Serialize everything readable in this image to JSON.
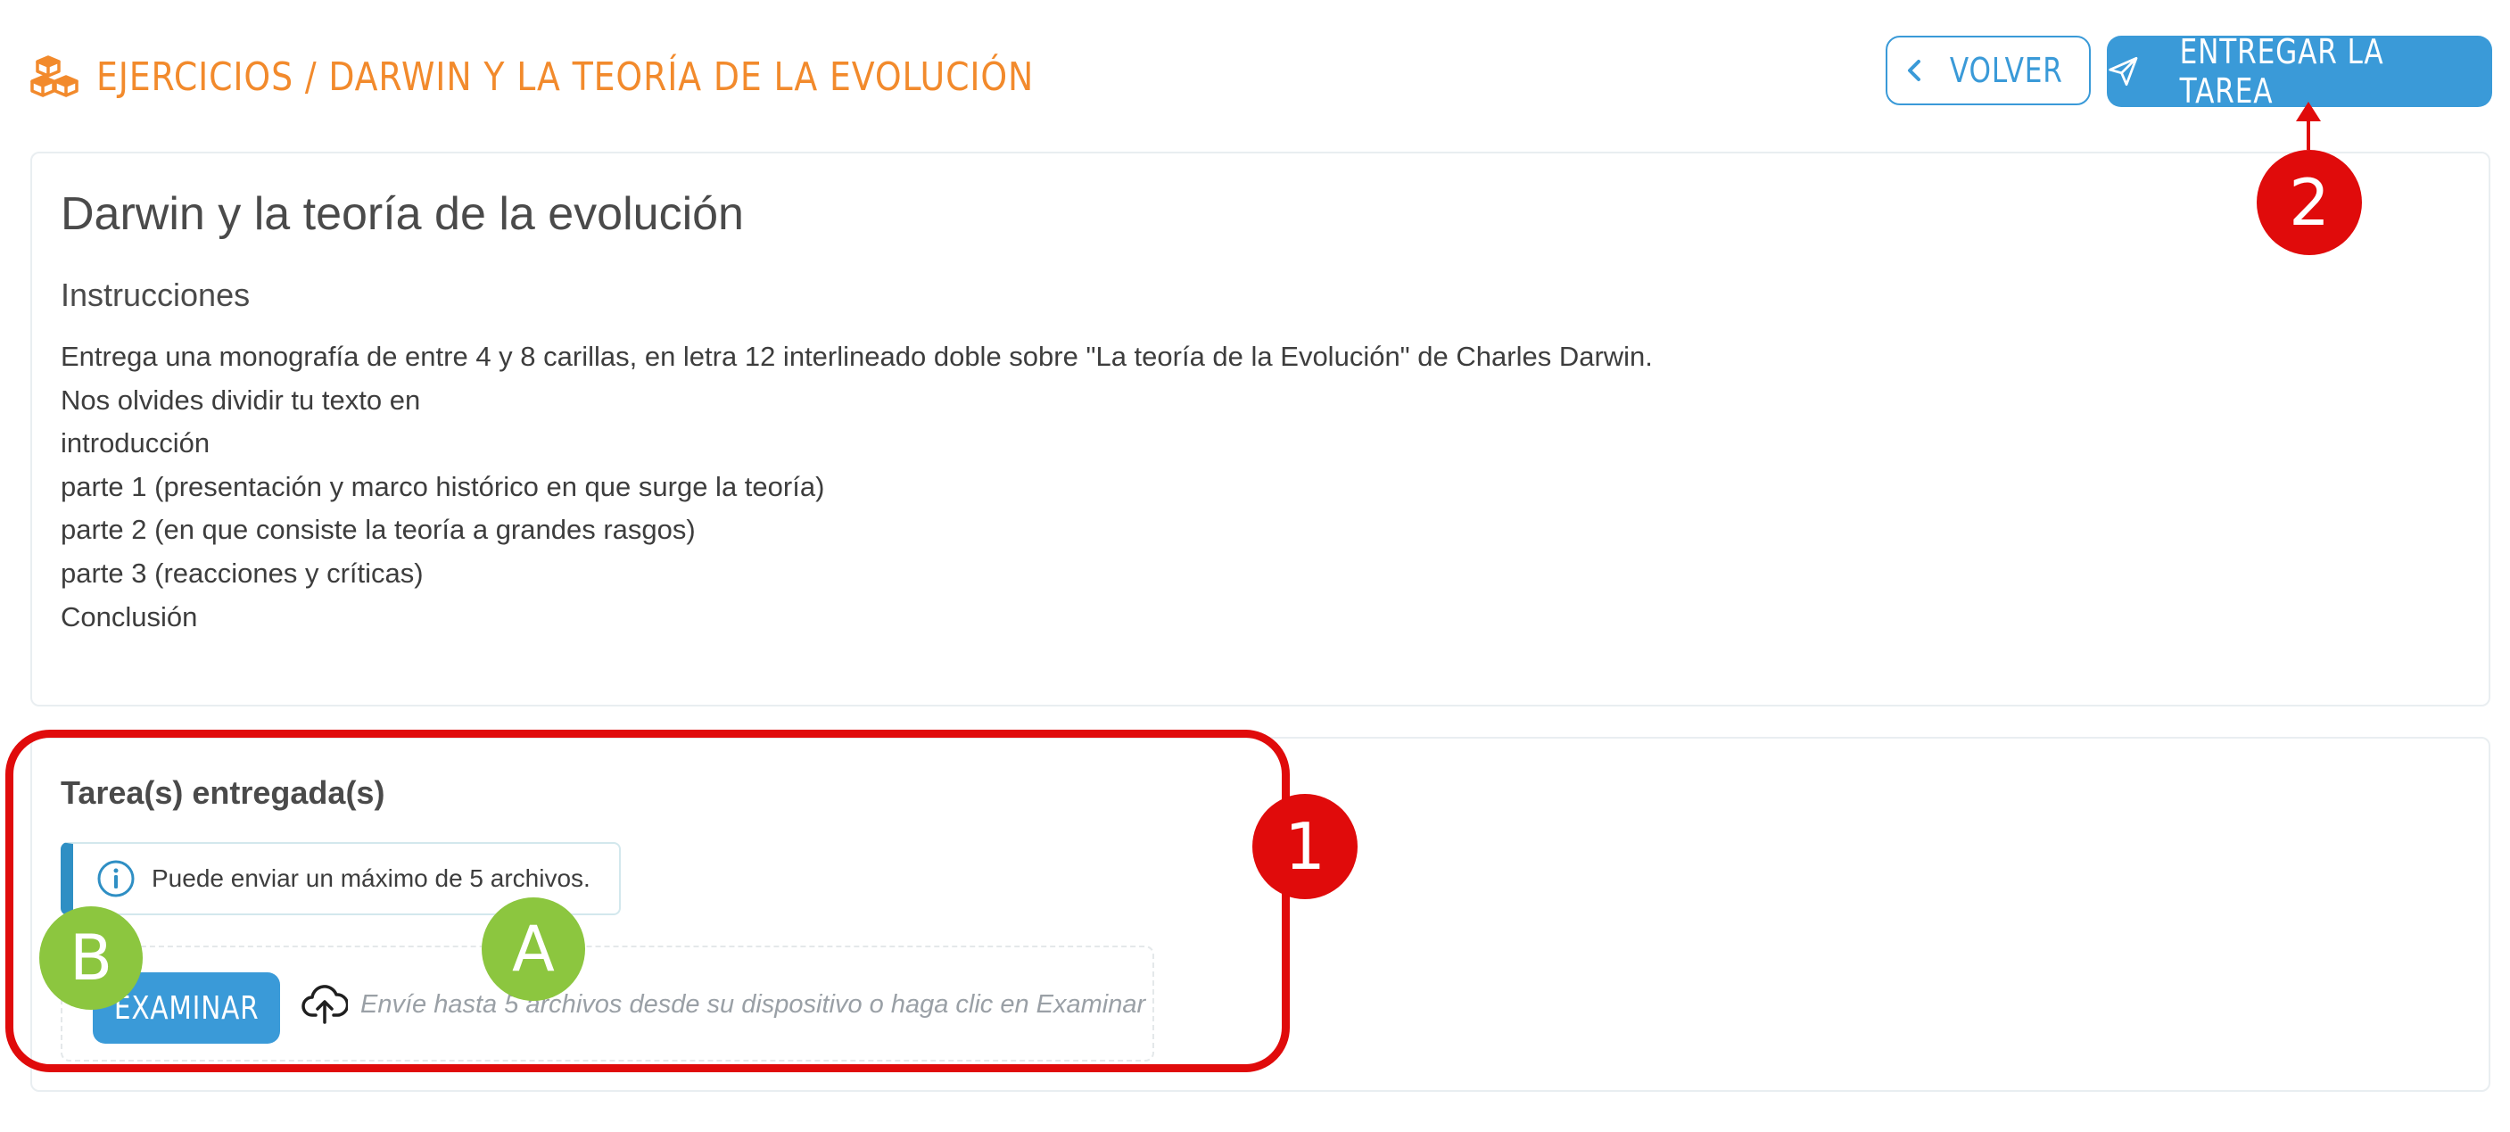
{
  "header": {
    "breadcrumb": "EJERCICIOS / DARWIN Y LA TEORÍA DE LA EVOLUCIÓN",
    "icon": "boxes-icon",
    "accent_color": "#f28a2c"
  },
  "actions": {
    "back_label": "VOLVER",
    "back_icon": "chevron-left-icon",
    "submit_label": "ENTREGAR LA TAREA",
    "submit_icon": "send-icon",
    "primary_color": "#3a9ad8"
  },
  "assignment": {
    "title": "Darwin y la teoría de la evolución",
    "instructions_heading": "Instrucciones",
    "instructions_lines": [
      "Entrega una monografía de entre 4 y 8 carillas, en letra 12 interlineado doble sobre \"La teoría de la Evolución\" de Charles Darwin.",
      "Nos olvides dividir tu texto en",
      "introducción",
      "parte 1 (presentación y marco histórico en que surge la teoría)",
      "parte 2 (en que consiste la teoría a grandes rasgos)",
      "parte 3 (reacciones y críticas)",
      "Conclusión"
    ]
  },
  "submissions": {
    "heading": "Tarea(s) entregada(s)",
    "info_text": "Puede enviar un máximo de 5 archivos.",
    "info_icon": "info-icon",
    "browse_label": "EXAMINAR",
    "upload_icon": "cloud-upload-icon",
    "dropzone_placeholder": "Envíe hasta 5 archivos desde su dispositivo o haga clic en Examinar"
  },
  "annotations": {
    "marker_1": "1",
    "marker_2": "2",
    "marker_a": "A",
    "marker_b": "B",
    "red_color": "#e00b0b",
    "green_color": "#8cc63f"
  }
}
